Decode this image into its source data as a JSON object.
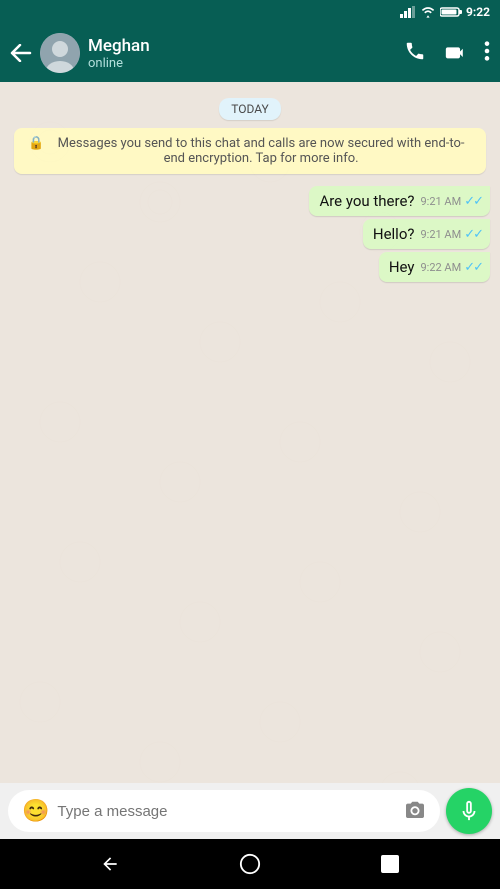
{
  "statusBar": {
    "time": "9:22",
    "icons": [
      "signal",
      "wifi",
      "battery"
    ]
  },
  "header": {
    "contactName": "Meghan",
    "contactStatus": "online",
    "backLabel": "←",
    "phoneIconLabel": "phone-call",
    "videoIconLabel": "video-call",
    "moreIconLabel": "more-options"
  },
  "chat": {
    "dateDivider": "TODAY",
    "encryptionNotice": "Messages you send to this chat and calls are now secured with end-to-end encryption. Tap for more info.",
    "messages": [
      {
        "text": "Are you there?",
        "time": "9:21 AM",
        "ticks": "✓✓"
      },
      {
        "text": "Hello?",
        "time": "9:21 AM",
        "ticks": "✓✓"
      },
      {
        "text": "Hey",
        "time": "9:22 AM",
        "ticks": "✓✓"
      }
    ]
  },
  "inputArea": {
    "placeholder": "Type a message",
    "emojiIcon": "😊",
    "cameraIconLabel": "camera"
  },
  "bottomNav": {
    "backLabel": "◄",
    "homeLabel": "⬤",
    "recentLabel": "■"
  }
}
